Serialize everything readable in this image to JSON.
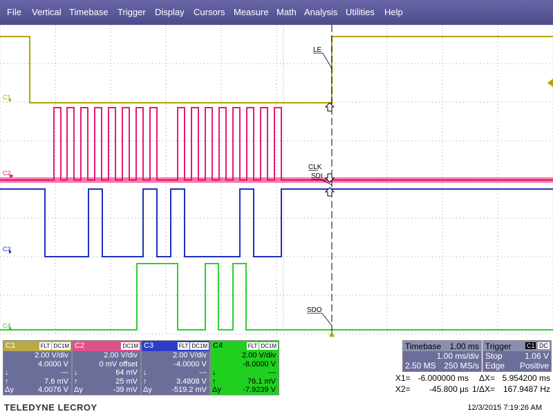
{
  "menu": [
    "File",
    "Vertical",
    "Timebase",
    "Trigger",
    "Display",
    "Cursors",
    "Measure",
    "Math",
    "Analysis",
    "Utilities",
    "Help"
  ],
  "colors": {
    "c1": "#b3a400",
    "c2": "#e8186e",
    "c3": "#1d2fc0",
    "c4": "#2ecf2e",
    "c1_panel": "#b8ab46",
    "c2_panel": "#e0508a",
    "c3_panel": "#2c3ec8",
    "c4_panel": "#1fd01f"
  },
  "screen": {
    "channel_labels": [
      "C1",
      "C2",
      "C3",
      "C4"
    ],
    "signal_labels": {
      "le": "LE",
      "clk": "CLK",
      "sdi": "SDI",
      "sdo": "SDO"
    }
  },
  "channels": [
    {
      "name": "C1",
      "tags": [
        "FLT",
        "DC1M"
      ],
      "vdiv": "2.00 V/div",
      "offset": "4.0000 V",
      "r1l": "↓",
      "r1v": "---",
      "r2l": "↑",
      "r2v": "7.6 mV",
      "r3l": "Δy",
      "r3v": "4.0076 V"
    },
    {
      "name": "C2",
      "tags": [
        "DC1M"
      ],
      "vdiv": "2.00 V/div",
      "offset": "0 mV offset",
      "r1l": "↓",
      "r1v": "64 mV",
      "r2l": "↑",
      "r2v": "25 mV",
      "r3l": "Δy",
      "r3v": "-39 mV"
    },
    {
      "name": "C3",
      "tags": [
        "FLT",
        "DC1M"
      ],
      "vdiv": "2.00 V/div",
      "offset": "-4.0000 V",
      "r1l": "↓",
      "r1v": "---",
      "r2l": "↑",
      "r2v": "3.4808 V",
      "r3l": "Δy",
      "r3v": "-519.2 mV"
    },
    {
      "name": "C4",
      "tags": [
        "FLT",
        "DC1M"
      ],
      "vdiv": "2.00 V/div",
      "offset": "-8.0000 V",
      "r1l": "↓",
      "r1v": "---",
      "r2l": "↑",
      "r2v": "76.1 mV",
      "r3l": "Δy",
      "r3v": "-7.9239 V"
    }
  ],
  "timebase": {
    "label": "Timebase",
    "delay": "1.00 ms",
    "tdiv": "1.00 ms/div",
    "samples": "2.50 MS",
    "rate": "250 MS/s"
  },
  "trigger": {
    "label": "Trigger",
    "tags": [
      "C1",
      "DC"
    ],
    "mode": "Stop",
    "level": "1.06 V",
    "type": "Edge",
    "slope": "Positive"
  },
  "cursors": {
    "x1_label": "X1=",
    "x1": "-6.000000 ms",
    "dx_label": "ΔX=",
    "dx": "5.954200 ms",
    "x2_label": "X2=",
    "x2": "-45.800 µs",
    "inv_label": "1/ΔX=",
    "inv": "167.9487 Hz"
  },
  "brand": "TELEDYNE LECROY",
  "datetime": "12/3/2015 7:19:26 AM"
}
